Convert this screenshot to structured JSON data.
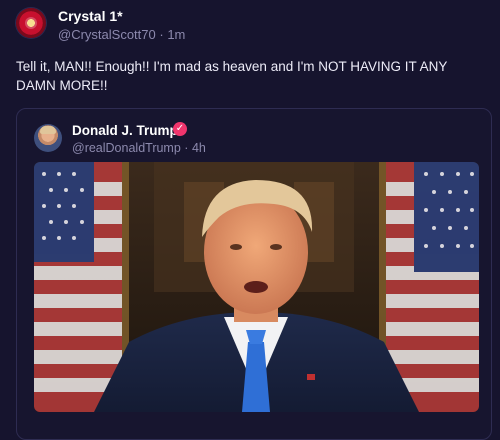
{
  "post": {
    "author_name": "Crystal 1*",
    "author_handle": "@CrystalScott70",
    "separator": "·",
    "time_ago": "1m",
    "text": "Tell it, MAN!! Enough!! I'm mad as heaven and I'm NOT HAVING IT ANY DAMN MORE!!"
  },
  "quoted_post": {
    "author_name": "Donald J. Trump",
    "author_handle": "@realDonaldTrump",
    "separator": "·",
    "time_ago": "4h",
    "verified_icon": "verified-badge-icon"
  },
  "colors": {
    "background": "#16142e",
    "verified_badge": "#f0356d",
    "muted_text": "#8c89ad"
  }
}
